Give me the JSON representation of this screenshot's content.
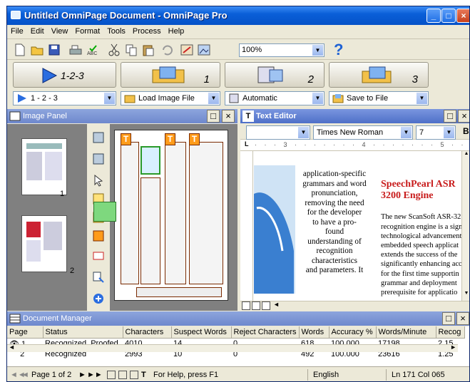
{
  "window": {
    "title": "Untitled OmniPage Document - OmniPage Pro"
  },
  "menu": [
    "File",
    "Edit",
    "View",
    "Format",
    "Tools",
    "Process",
    "Help"
  ],
  "toolbar": {
    "zoom": "100%"
  },
  "process_buttons": [
    {
      "label": "1-2-3",
      "num": ""
    },
    {
      "label": "",
      "num": "1"
    },
    {
      "label": "",
      "num": "2"
    },
    {
      "label": "",
      "num": "3"
    }
  ],
  "dropdowns": {
    "workflow": "1 - 2 - 3",
    "input": "Load Image File",
    "recognition": "Automatic",
    "output": "Save to File"
  },
  "image_panel": {
    "title": "Image Panel",
    "thumbs": [
      {
        "number": "1"
      },
      {
        "number": "2"
      }
    ]
  },
  "text_editor": {
    "title": "Text Editor",
    "font": "Times New Roman",
    "size": "7",
    "left_column": "application-specific\ngrammars and word\npronunciation,\nremoving the need\nfor the developer\nto have a pro-\nfound\nunderstanding of\nrecognition\ncharacteristics\nand parameters. It",
    "right_heading": "SpeechPearl ASR\n3200 Engine",
    "right_column": "The new ScanSoft ASR-32\nrecognition engine is a sign\ntechnological advancement\nembedded speech applicat\nextends the success of the\nsignificantly enhancing acc\nfor the first time supportin\ngrammar and deployment\nprerequisite for applicatio"
  },
  "doc_manager": {
    "title": "Document Manager",
    "columns": [
      "Page",
      "Status",
      "Characters",
      "Suspect Words",
      "Reject Characters",
      "Words",
      "Accuracy %",
      "Words/Minute",
      "Recog"
    ],
    "rows": [
      {
        "page": "1...",
        "status": "Recognized, Proofed",
        "characters": "4010",
        "suspect": "14",
        "reject": "0",
        "words": "618",
        "accuracy": "100.000",
        "wpm": "17198",
        "recog": "2.15"
      },
      {
        "page": "2",
        "status": "Recognized",
        "characters": "2993",
        "suspect": "10",
        "reject": "0",
        "words": "492",
        "accuracy": "100.000",
        "wpm": "23616",
        "recog": "1.25"
      }
    ]
  },
  "status": {
    "page": "Page 1 of 2",
    "help": "For Help, press F1",
    "language": "English",
    "position": "Ln 171  Col 065"
  }
}
